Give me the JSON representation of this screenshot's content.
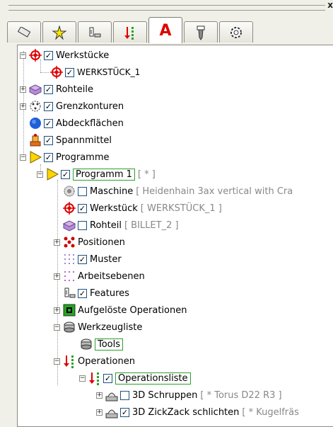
{
  "window": {
    "close_glyph": "x"
  },
  "tabs": [
    {
      "icon": "eraser-icon"
    },
    {
      "icon": "sparkle-icon"
    },
    {
      "icon": "tool-holder-icon"
    },
    {
      "icon": "operation-icon"
    },
    {
      "icon": "letter-a-icon",
      "label": "A"
    },
    {
      "icon": "drill-icon"
    },
    {
      "icon": "gear-icon"
    }
  ],
  "tree": {
    "werkstuecke": "Werkstücke",
    "werkstueck1": "WERKSTÜCK_1",
    "rohteile": "Rohteile",
    "grenzkonturen": "Grenzkonturen",
    "abdeckflaechen": "Abdeckflächen",
    "spannmittel": "Spannmittel",
    "programme": "Programme",
    "programm1": "Programm 1",
    "programm1_extra": "[ * ]",
    "maschine": "Maschine",
    "maschine_extra": "[ Heidenhain 3ax vertical with Cra",
    "werkstueck": "Werkstück",
    "werkstueck_extra": "[ WERKSTÜCK_1 ]",
    "rohteil": "Rohteil",
    "rohteil_extra": "[ BILLET_2 ]",
    "positionen": "Positionen",
    "muster": "Muster",
    "arbeitsebenen": "Arbeitsebenen",
    "features": "Features",
    "aufgeloeste": "Aufgelöste Operationen",
    "werkzeugliste": "Werkzeugliste",
    "tools": "Tools",
    "operationen": "Operationen",
    "operationsliste": "Operationsliste",
    "schruppen": "3D Schruppen",
    "schruppen_extra": "[ * Torus D22 R3 ]",
    "zickzack": "3D ZickZack schlichten",
    "zickzack_extra": "[ * Kugelfräs"
  },
  "colors": {
    "accent_red": "#e00000",
    "accent_green": "#2aa12a",
    "frame": "#f0efe8"
  }
}
